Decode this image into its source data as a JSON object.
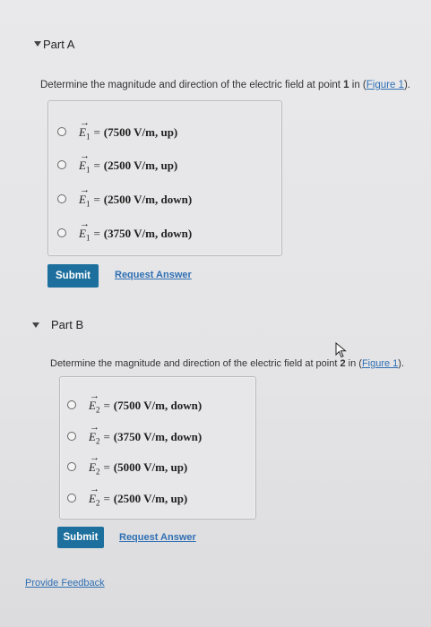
{
  "partA": {
    "title": "Part A",
    "question_prefix": "Determine the magnitude and direction of the electric field at point ",
    "point": "1",
    "question_mid": " in (",
    "figure_link": "Figure 1",
    "question_suffix": ").",
    "options": [
      {
        "sub": "1",
        "value": "(7500 V/m, up)"
      },
      {
        "sub": "1",
        "value": "(2500 V/m, up)"
      },
      {
        "sub": "1",
        "value": "(2500 V/m, down)"
      },
      {
        "sub": "1",
        "value": "(3750 V/m, down)"
      }
    ],
    "submit_label": "Submit",
    "request_label": "Request Answer"
  },
  "partB": {
    "title": "Part B",
    "question_prefix": "Determine the magnitude and direction of the electric field at point ",
    "point": "2",
    "question_mid": " in (",
    "figure_link": "Figure 1",
    "question_suffix": ").",
    "options": [
      {
        "sub": "2",
        "value": "(7500 V/m, down)"
      },
      {
        "sub": "2",
        "value": "(3750 V/m, down)"
      },
      {
        "sub": "2",
        "value": "(5000 V/m, up)"
      },
      {
        "sub": "2",
        "value": "(2500 V/m, up)"
      }
    ],
    "submit_label": "Submit",
    "request_label": "Request Answer"
  },
  "feedback_label": "Provide Feedback",
  "symbols": {
    "E": "E",
    "eq": "=",
    "arrow": "→"
  }
}
